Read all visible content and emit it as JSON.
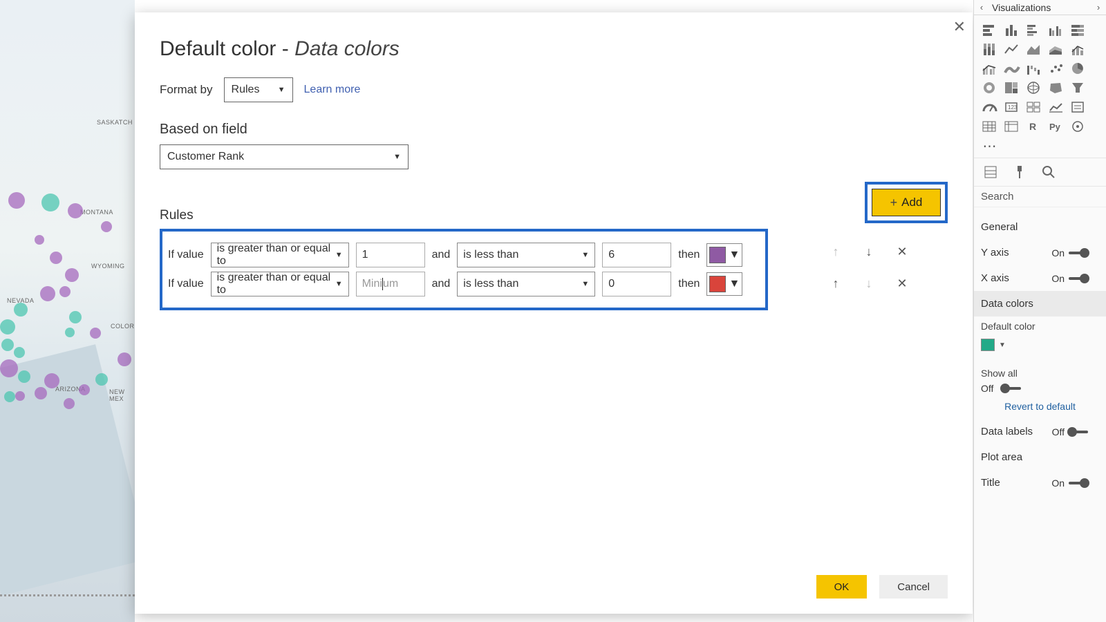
{
  "rightPane": {
    "title": "Visualizations",
    "searchLabel": "Search",
    "sections": {
      "general": "General",
      "yAxis": "Y axis",
      "xAxis": "X axis",
      "dataColors": "Data colors",
      "defaultColor": "Default color",
      "showAll": "Show all",
      "dataLabels": "Data labels",
      "plotArea": "Plot area",
      "title": "Title",
      "revert": "Revert to default"
    },
    "toggles": {
      "yAxis": "On",
      "xAxis": "On",
      "showAll": "Off",
      "dataLabels": "Off",
      "title": "On"
    },
    "defaultColorSwatch": "#2a9d8f"
  },
  "dialog": {
    "titlePrefix": "Default color - ",
    "titleEm": "Data colors",
    "formatByLabel": "Format by",
    "formatByValue": "Rules",
    "learnMore": "Learn more",
    "basedOnLabel": "Based on field",
    "basedOnValue": "Customer Rank",
    "rulesLabel": "Rules",
    "addLabel": "Add",
    "okLabel": "OK",
    "cancelLabel": "Cancel",
    "ruleText": {
      "ifValue": "If value",
      "and": "and",
      "then": "then"
    },
    "rules": [
      {
        "op1": "is greater than or equal to",
        "val1": "1",
        "val1Placeholder": "",
        "op2": "is less than",
        "val2": "6",
        "color": "#8f5aa3",
        "upDisabled": true,
        "downDisabled": false
      },
      {
        "op1": "is greater than or equal to",
        "val1": "",
        "val1Placeholder": "Minimum",
        "op2": "is less than",
        "val2": "0",
        "color": "#d9443b",
        "upDisabled": false,
        "downDisabled": true
      }
    ]
  },
  "mapLabels": {
    "saskatch": "SASKATCH",
    "montana": "MONTANA",
    "wyoming": "WYOMING",
    "nevada": "NEVADA",
    "colorado": "COLOR",
    "arizona": "ARIZONA",
    "newMexico": "NEW MEX"
  }
}
